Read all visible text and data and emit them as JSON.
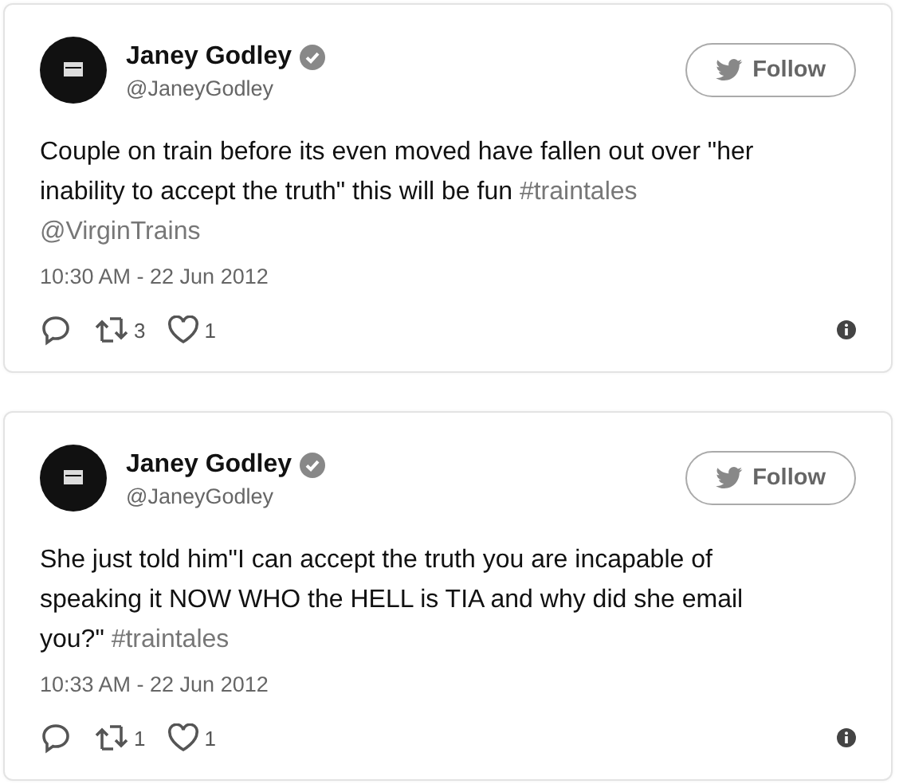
{
  "tweets": [
    {
      "name": "Janey Godley",
      "verified": true,
      "handle": "@JaneyGodley",
      "follow": "Follow",
      "body": [
        {
          "kind": "text",
          "text": "Couple on train before its even moved have fallen out over \"her inability to accept the truth\" this will be fun "
        },
        {
          "kind": "link",
          "text": "#traintales"
        },
        {
          "kind": "link",
          "text": "@VirginTrains"
        }
      ],
      "time": "10:30 AM - 22 Jun 2012",
      "retweets": "3",
      "likes": "1"
    },
    {
      "name": "Janey Godley",
      "verified": true,
      "handle": "@JaneyGodley",
      "follow": "Follow",
      "body": [
        {
          "kind": "text",
          "text": "She just told him\"I can accept the truth you are incapable of speaking it NOW WHO the HELL is TIA and why did she email you?\" "
        },
        {
          "kind": "link",
          "text": "#traintales"
        }
      ],
      "time": "10:33 AM - 22 Jun 2012",
      "retweets": "1",
      "likes": "1"
    }
  ]
}
